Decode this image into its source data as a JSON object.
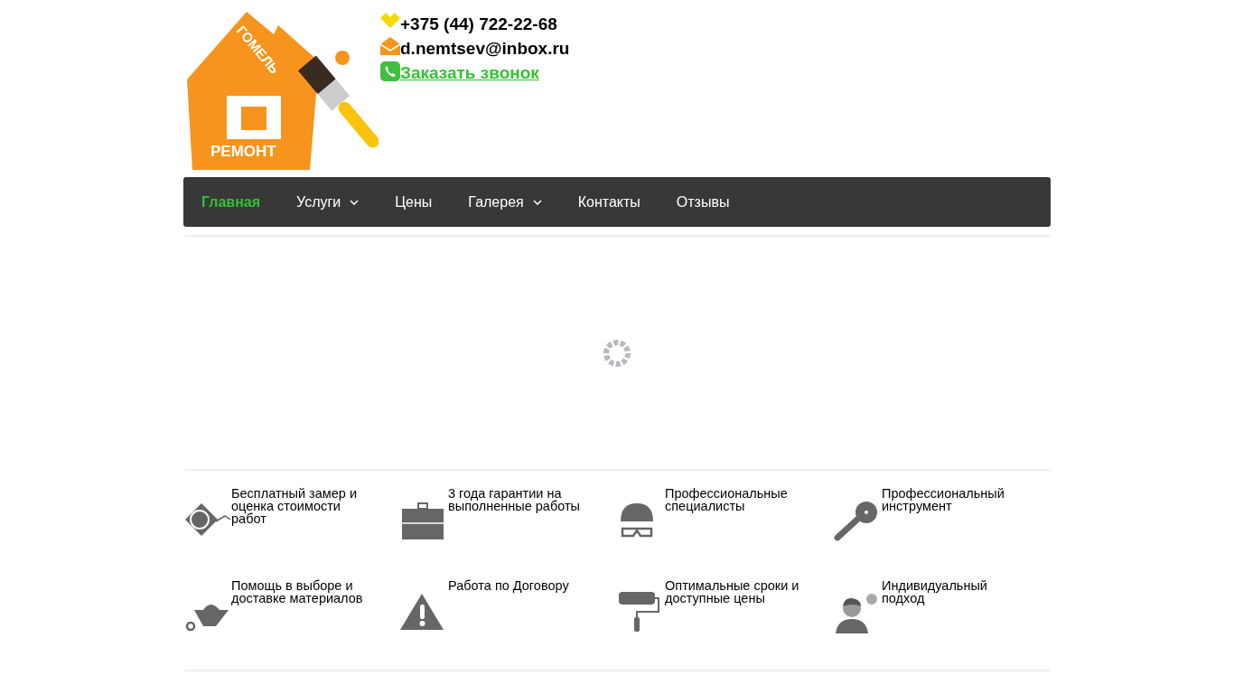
{
  "logo": {
    "top_text": "ГОМЕЛЬ",
    "bottom_text": "РЕМОНТ"
  },
  "contacts": {
    "phone": "+375 (44) 722-22-68",
    "email": "d.nemtsev@inbox.ru",
    "callback_link": "Заказать звонок"
  },
  "nav": [
    {
      "label": "Главная",
      "selected": true,
      "dropdown": false
    },
    {
      "label": "Услуги",
      "selected": false,
      "dropdown": true
    },
    {
      "label": "Цены",
      "selected": false,
      "dropdown": false
    },
    {
      "label": "Галерея",
      "selected": false,
      "dropdown": true
    },
    {
      "label": "Контакты",
      "selected": false,
      "dropdown": false
    },
    {
      "label": "Отзывы",
      "selected": false,
      "dropdown": false
    }
  ],
  "features": [
    {
      "kind": "tape",
      "text": "Бесплатный замер и оценка стоимости работ"
    },
    {
      "kind": "case",
      "text": "3 года гарантии на выполненные работы"
    },
    {
      "kind": "helmet",
      "text": "Профессиональные специалисты"
    },
    {
      "kind": "grinder",
      "text": "Профессиональный инструмент"
    },
    {
      "kind": "barrow",
      "text": "Помощь в выборе и доставке материалов"
    },
    {
      "kind": "warning",
      "text": "Работа по Договору"
    },
    {
      "kind": "roller",
      "text": "Оптимальные сроки и доступные цены"
    },
    {
      "kind": "person",
      "text": "Индивидуальный подход"
    }
  ]
}
